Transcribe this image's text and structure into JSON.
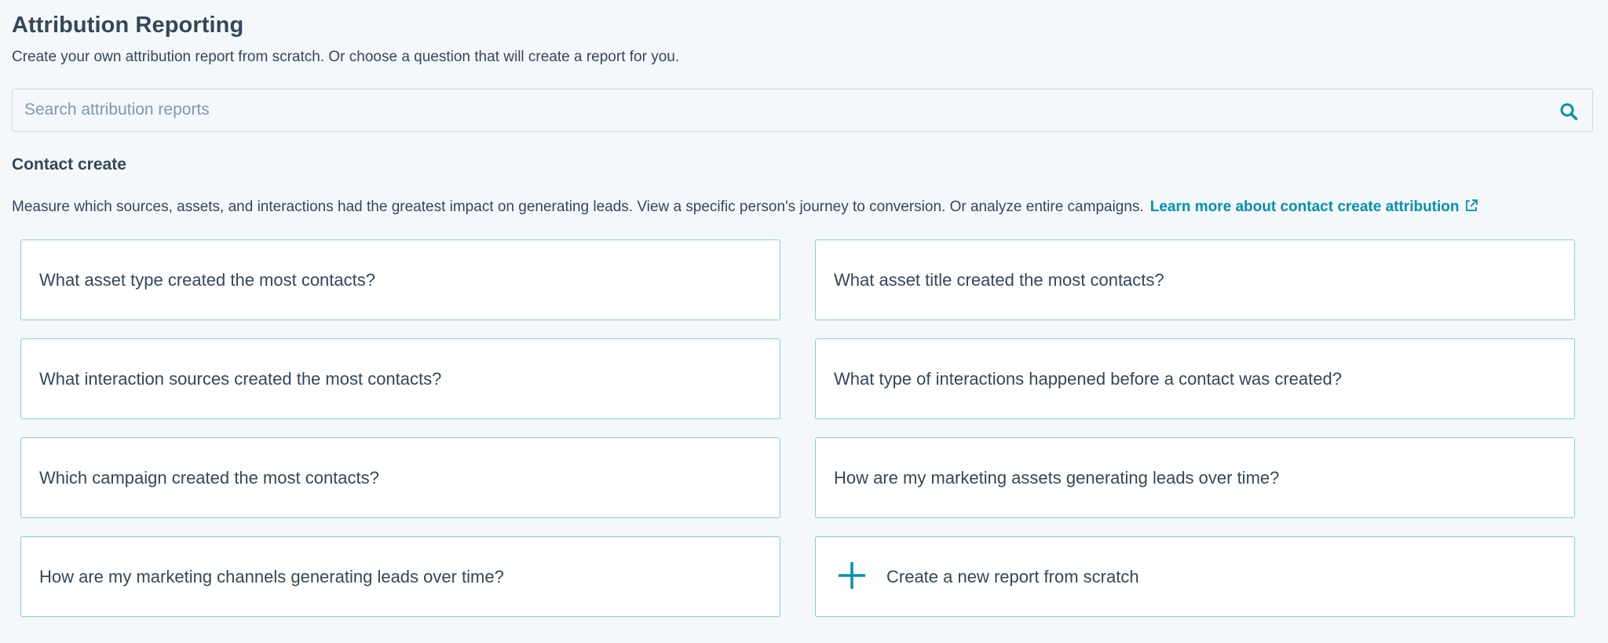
{
  "header": {
    "title": "Attribution Reporting",
    "subtitle": "Create your own attribution report from scratch. Or choose a question that will create a report for you."
  },
  "search": {
    "placeholder": "Search attribution reports",
    "value": "",
    "icon": "search-icon"
  },
  "section": {
    "title": "Contact create",
    "description": "Measure which sources, assets, and interactions had the greatest impact on generating leads. View a specific person's journey to conversion. Or analyze entire campaigns.",
    "link_label": "Learn more about contact create attribution",
    "link_icon": "external-link-icon"
  },
  "cards": [
    {
      "label": "What asset type created the most contacts?"
    },
    {
      "label": "What asset title created the most contacts?"
    },
    {
      "label": "What interaction sources created the most contacts?"
    },
    {
      "label": "What type of interactions happened before a contact was created?"
    },
    {
      "label": "Which campaign created the most contacts?"
    },
    {
      "label": "How are my marketing assets generating leads over time?"
    },
    {
      "label": "How are my marketing channels generating leads over time?"
    },
    {
      "label": "Create a new report from scratch",
      "icon": "plus-icon"
    }
  ],
  "colors": {
    "background": "#f5f8fa",
    "text": "#33475b",
    "accent": "#0091ae",
    "card_border": "#7fd1de",
    "placeholder": "#7c98b6"
  }
}
